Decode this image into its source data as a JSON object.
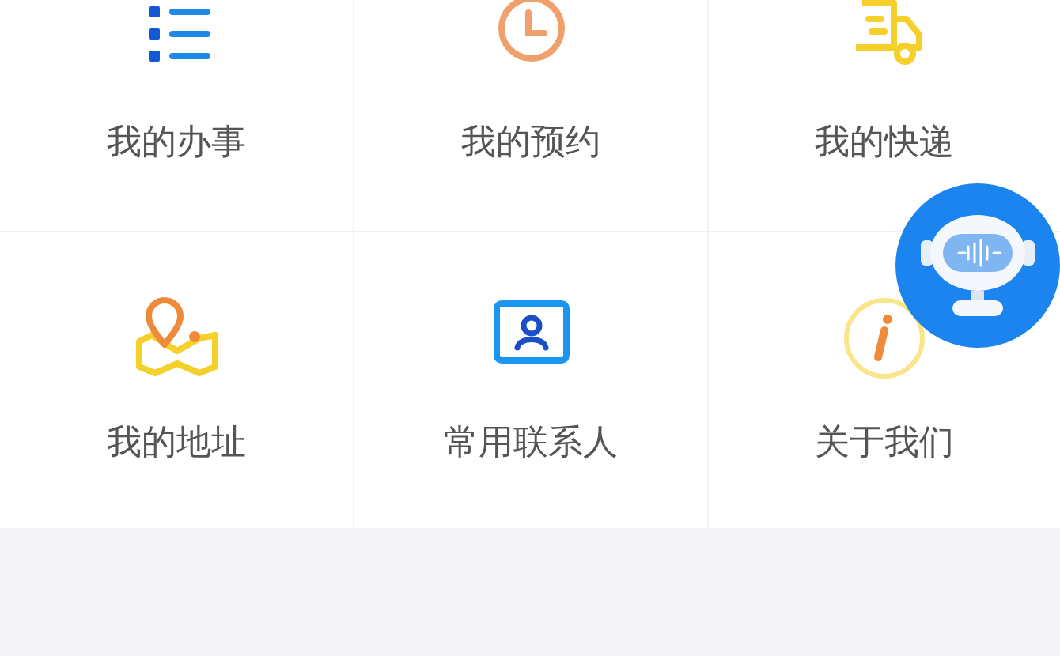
{
  "menu_rows": [
    {
      "items": [
        {
          "label": "我的办事"
        },
        {
          "label": "我的预约"
        },
        {
          "label": "我的快递"
        }
      ]
    },
    {
      "items": [
        {
          "label": "我的地址"
        },
        {
          "label": "常用联系人"
        },
        {
          "label": "关于我们"
        }
      ]
    }
  ]
}
